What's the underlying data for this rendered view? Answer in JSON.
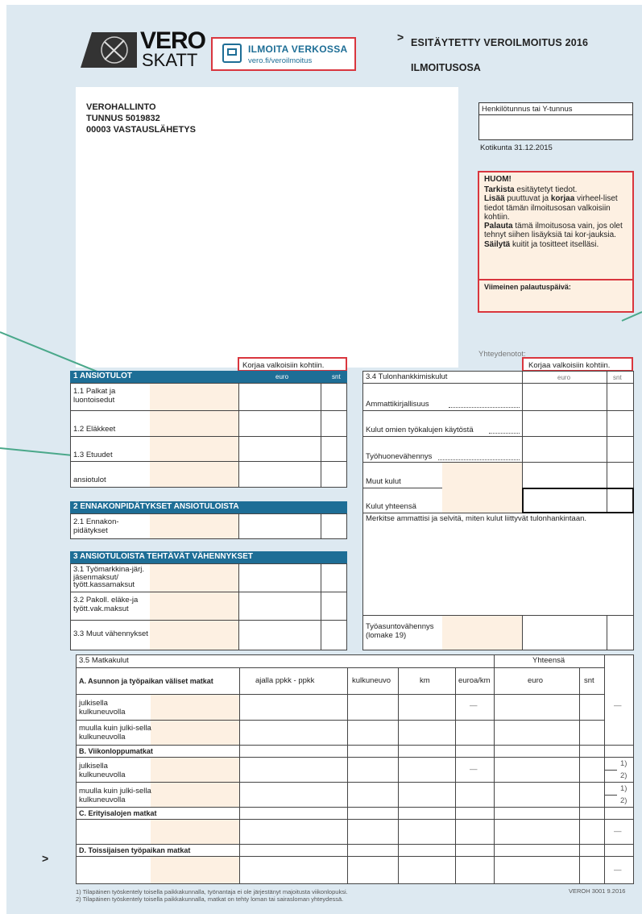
{
  "header": {
    "logo_main": "VERO",
    "logo_sub": "SKATT",
    "online_title": "ILMOITA VERKOSSA",
    "online_url": "vero.fi/veroilmoitus",
    "arrow": ">",
    "form_title": "ESITÄYTETTY VEROILMOITUS 2016",
    "form_subtitle": "ILMOITUSOSA"
  },
  "address": {
    "line1": "VEROHALLINTO",
    "line2": "TUNNUS 5019832",
    "line3": "00003 VASTAUSLÄHETYS"
  },
  "side": {
    "id_label": "Henkilötunnus tai Y-tunnus",
    "municipality": "Kotikunta 31.12.2015",
    "note_title": "HUOM!",
    "note_p1_bold": "Tarkista",
    "note_p1": " esitäytetyt tiedot.",
    "note_p2_bold": "Lisää",
    "note_p2a": " puuttuvat ja ",
    "note_p2_bold2": "korjaa",
    "note_p2b": " virheel-liset tiedot tämän ilmoitusosan valkoisiin kohtiin.",
    "note_p3_bold": "Palauta",
    "note_p3": " tämä ilmoitusosa vain, jos olet tehnyt siihen lisäyksiä tai kor-jauksia.",
    "note_p4_bold": "Säilytä",
    "note_p4": " kuitit ja tositteet itselläsi.",
    "deadline_label": "Viimeinen palautuspäivä:",
    "contacts": "Yhteydenotot:"
  },
  "left": {
    "correct_note": "Korjaa valkoisiin kohtiin.",
    "s1_title": "1 ANSIOTULOT",
    "col_euro": "euro",
    "col_snt": "snt",
    "s1_rows": [
      "1.1 Palkat ja luontoisedut",
      "1.2 Eläkkeet",
      "1.3 Etuudet",
      "ansiotulot"
    ],
    "s2_title": "2 ENNAKONPIDÄTYKSET ANSIOTULOISTA",
    "s2_rows": [
      "2.1 Ennakon-pidätykset"
    ],
    "s3_title": "3 ANSIOTULOISTA TEHTÄVÄT VÄHENNYKSET",
    "s3_rows": [
      "3.1 Työmarkkina-järj. jäsenmaksut/ tyött.kassamaksut",
      "3.2 Pakoll. eläke-ja tyött.vak.maksut",
      "3.3 Muut vähennykset"
    ]
  },
  "right": {
    "correct_note": "Korjaa valkoisiin kohtiin.",
    "s34_title": "3.4 Tulonhankkimiskulut",
    "col_euro": "euro",
    "col_snt": "snt",
    "rows": [
      "Ammattikirjallisuus",
      "Kulut omien työkalujen käytöstä",
      "Työhuonevähennys",
      "Muut kulut",
      "Kulut yhteensä"
    ],
    "explain": "Merkitse ammattisi ja selvitä, miten kulut liittyvät tulonhankintaan.",
    "home_label": "Työasuntovähennys (lomake 19)"
  },
  "travel": {
    "title": "3.5 Matkakulut",
    "total_label": "Yhteensä",
    "secA": "A. Asunnon ja työpaikan väliset matkat",
    "cols": [
      "ajalla ppkk - ppkk",
      "kulkuneuvo",
      "km",
      "euroa/km",
      "euro",
      "snt"
    ],
    "rowA1": "julkisella kulkuneuvolla",
    "rowA2": "muulla kuin julki-sella kulkuneuvolla",
    "secB": "B. Viikonloppumatkat",
    "rowB1": "julkisella kulkuneuvolla",
    "rowB2": "muulla kuin julki-sella kulkuneuvolla",
    "secC": "C. Erityisalojen matkat",
    "secD": "D. Toissijaisen työpaikan matkat",
    "dash": "—",
    "ref1": "1)",
    "ref2": "2)"
  },
  "footer": {
    "note1": "1) Tilapäinen työskentely toisella paikkakunnalla, työnantaja ei ole järjestänyt majoitusta viikonlopuksi.",
    "note2": "2) Tilapäinen työskentely toisella paikkakunnalla, matkat on tehty loman tai sairasloman yhteydessä.",
    "form_code": "VEROH 3001 9.2016",
    "margin_arrow": ">"
  },
  "colors": {
    "blue_header": "#1e6e96",
    "red_frame": "#d9363e",
    "green_line": "#4aa88a",
    "sheet_bg": "#dde9f1",
    "peach": "#fdf0e2"
  }
}
